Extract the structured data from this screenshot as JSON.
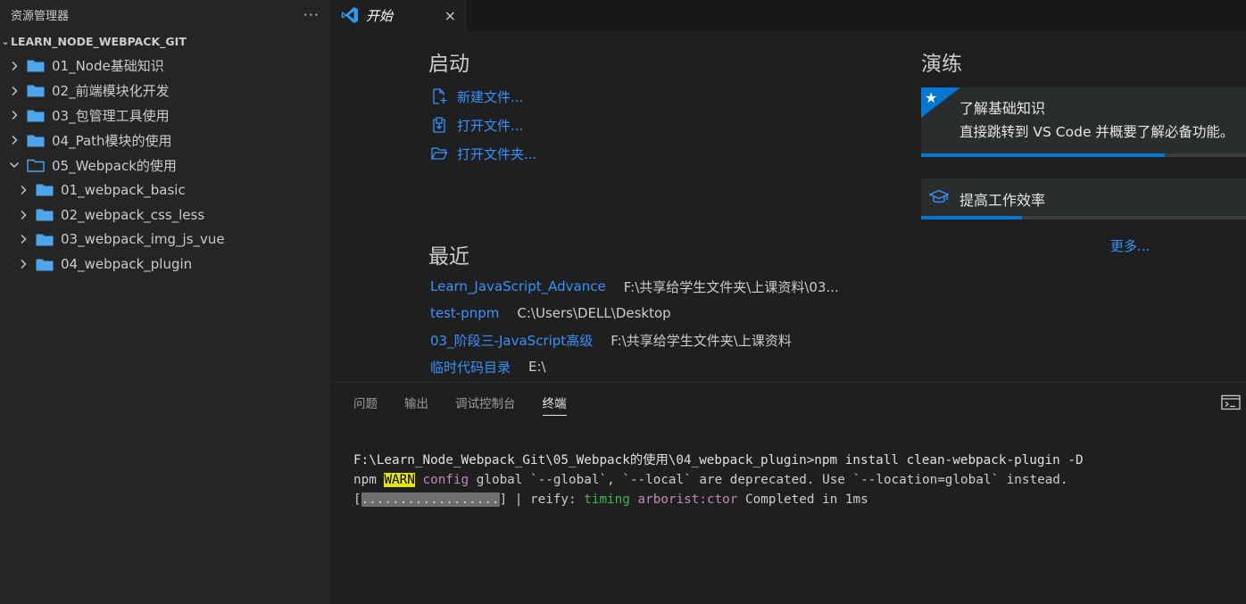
{
  "sidebar": {
    "title": "资源管理器",
    "more": "···",
    "section": "LEARN_NODE_WEBPACK_GIT",
    "items": [
      {
        "label": "01_Node基础知识",
        "level": 0,
        "expanded": false
      },
      {
        "label": "02_前端模块化开发",
        "level": 0,
        "expanded": false
      },
      {
        "label": "03_包管理工具使用",
        "level": 0,
        "expanded": false
      },
      {
        "label": "04_Path模块的使用",
        "level": 0,
        "expanded": false
      },
      {
        "label": "05_Webpack的使用",
        "level": 0,
        "expanded": true
      },
      {
        "label": "01_webpack_basic",
        "level": 1,
        "expanded": false
      },
      {
        "label": "02_webpack_css_less",
        "level": 1,
        "expanded": false
      },
      {
        "label": "03_webpack_img_js_vue",
        "level": 1,
        "expanded": false
      },
      {
        "label": "04_webpack_plugin",
        "level": 1,
        "expanded": false
      }
    ]
  },
  "editor": {
    "tab_label": "开始",
    "close": "×"
  },
  "welcome": {
    "start_heading": "启动",
    "start_items": [
      {
        "label": "新建文件...",
        "icon": "new-file-icon"
      },
      {
        "label": "打开文件...",
        "icon": "open-file-icon"
      },
      {
        "label": "打开文件夹...",
        "icon": "open-folder-icon"
      }
    ],
    "recent_heading": "最近",
    "recent": [
      {
        "name": "Learn_JavaScript_Advance",
        "path": "F:\\共享给学生文件夹\\上课资料\\03..."
      },
      {
        "name": "test-pnpm",
        "path": "C:\\Users\\DELL\\Desktop"
      },
      {
        "name": "03_阶段三-JavaScript高级",
        "path": "F:\\共享给学生文件夹\\上课资料"
      },
      {
        "name": "临时代码目录",
        "path": "E:\\"
      }
    ],
    "walk_heading": "演练",
    "walk_card1": {
      "title": "了解基础知识",
      "desc": "直接跳转到 VS Code 并概要了解必备功能。",
      "progress": 0.75
    },
    "walk_card2": {
      "title": "提高工作效率",
      "progress": 0.31
    },
    "more": "更多..."
  },
  "panel": {
    "tabs": [
      "问题",
      "输出",
      "调试控制台",
      "终端"
    ],
    "active_tab": "终端",
    "terminal": {
      "line1": "F:\\Learn_Node_Webpack_Git\\05_Webpack的使用\\04_webpack_plugin>npm install clean-webpack-plugin -D",
      "l2_npm": "npm",
      "l2_warn": "WARN",
      "l2_config": "config",
      "l2_rest": "global `--global`, `--local` are deprecated. Use `--location=global` instead.",
      "l3_open": "[",
      "l3_bar": "..................",
      "l3_close": "]",
      "l3_sep": " | reify:",
      "l3_timing": "timing",
      "l3_arborist": "arborist:ctor",
      "l3_rest": "Completed in 1ms"
    }
  },
  "colors": {
    "accent": "#0078d4",
    "link": "#3794ff",
    "warn_bg": "#e5e500"
  }
}
